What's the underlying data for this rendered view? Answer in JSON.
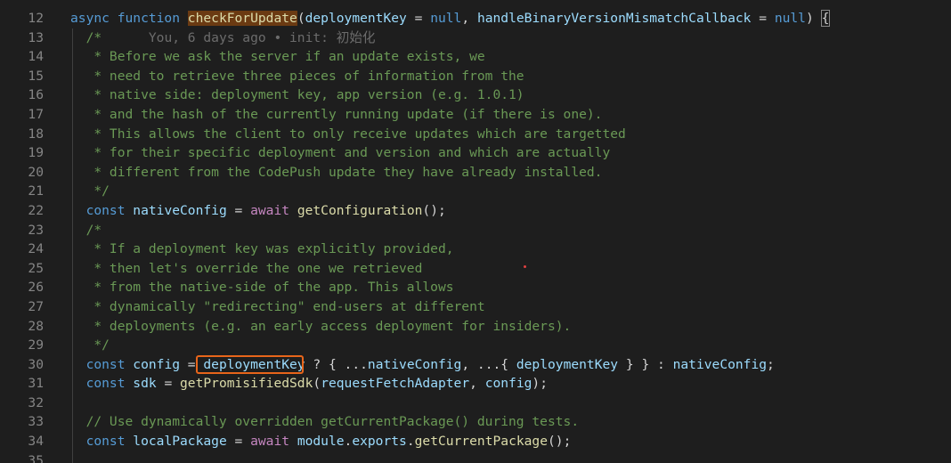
{
  "editor": {
    "lines": [
      {
        "n": "12",
        "parts": [
          {
            "t": "async ",
            "c": "kw"
          },
          {
            "t": "function ",
            "c": "kw"
          },
          {
            "t": "checkForUpdate",
            "c": "fn hl-fn"
          },
          {
            "t": "(",
            "c": "pl"
          },
          {
            "t": "deploymentKey",
            "c": "var"
          },
          {
            "t": " = ",
            "c": "pl"
          },
          {
            "t": "null",
            "c": "kw"
          },
          {
            "t": ", ",
            "c": "pl"
          },
          {
            "t": "handleBinaryVersionMismatchCallback",
            "c": "var"
          },
          {
            "t": " = ",
            "c": "pl"
          },
          {
            "t": "null",
            "c": "kw"
          },
          {
            "t": ") ",
            "c": "pl"
          },
          {
            "t": "{",
            "c": "pl brace"
          }
        ]
      },
      {
        "n": "13",
        "parts": [
          {
            "t": "  /*",
            "c": "cm"
          },
          {
            "t": "      You, 6 days ago • init: 初始化",
            "c": "blame"
          }
        ]
      },
      {
        "n": "14",
        "parts": [
          {
            "t": "   * Before we ask the server if an update exists, we",
            "c": "cm"
          }
        ]
      },
      {
        "n": "15",
        "parts": [
          {
            "t": "   * need to retrieve three pieces of information from the",
            "c": "cm"
          }
        ]
      },
      {
        "n": "16",
        "parts": [
          {
            "t": "   * native side: deployment key, app version (e.g. 1.0.1)",
            "c": "cm"
          }
        ]
      },
      {
        "n": "17",
        "parts": [
          {
            "t": "   * and the hash of the currently running update (if there is one).",
            "c": "cm"
          }
        ]
      },
      {
        "n": "18",
        "parts": [
          {
            "t": "   * This allows the client to only receive updates which are targetted",
            "c": "cm"
          }
        ]
      },
      {
        "n": "19",
        "parts": [
          {
            "t": "   * for their specific deployment and version and which are actually",
            "c": "cm"
          }
        ]
      },
      {
        "n": "20",
        "parts": [
          {
            "t": "   * different from the CodePush update they have already installed.",
            "c": "cm"
          }
        ]
      },
      {
        "n": "21",
        "parts": [
          {
            "t": "   */",
            "c": "cm"
          }
        ]
      },
      {
        "n": "22",
        "parts": [
          {
            "t": "  ",
            "c": "pl"
          },
          {
            "t": "const ",
            "c": "kw"
          },
          {
            "t": "nativeConfig",
            "c": "var"
          },
          {
            "t": " = ",
            "c": "pl"
          },
          {
            "t": "await ",
            "c": "ctl"
          },
          {
            "t": "getConfiguration",
            "c": "fn"
          },
          {
            "t": "();",
            "c": "pl"
          }
        ]
      },
      {
        "n": "23",
        "parts": [
          {
            "t": "  /*",
            "c": "cm"
          }
        ]
      },
      {
        "n": "24",
        "parts": [
          {
            "t": "   * If a deployment key was explicitly provided,",
            "c": "cm"
          }
        ]
      },
      {
        "n": "25",
        "parts": [
          {
            "t": "   * then let's override the one we retrieved",
            "c": "cm"
          }
        ]
      },
      {
        "n": "26",
        "parts": [
          {
            "t": "   * from the native-side of the app. This allows",
            "c": "cm"
          }
        ]
      },
      {
        "n": "27",
        "parts": [
          {
            "t": "   * dynamically \"redirecting\" end-users at different",
            "c": "cm"
          }
        ]
      },
      {
        "n": "28",
        "parts": [
          {
            "t": "   * deployments (e.g. an early access deployment for insiders).",
            "c": "cm"
          }
        ]
      },
      {
        "n": "29",
        "parts": [
          {
            "t": "   */",
            "c": "cm"
          }
        ]
      },
      {
        "n": "30",
        "parts": [
          {
            "t": "  ",
            "c": "pl"
          },
          {
            "t": "const ",
            "c": "kw"
          },
          {
            "t": "config",
            "c": "var"
          },
          {
            "t": " = ",
            "c": "pl"
          },
          {
            "t": "deploymentKey",
            "c": "var"
          },
          {
            "t": " ? { ...",
            "c": "pl"
          },
          {
            "t": "nativeConfig",
            "c": "var"
          },
          {
            "t": ", ...{ ",
            "c": "pl"
          },
          {
            "t": "deploymentKey",
            "c": "var"
          },
          {
            "t": " } } : ",
            "c": "pl"
          },
          {
            "t": "nativeConfig",
            "c": "var"
          },
          {
            "t": ";",
            "c": "pl"
          }
        ]
      },
      {
        "n": "31",
        "parts": [
          {
            "t": "  ",
            "c": "pl"
          },
          {
            "t": "const ",
            "c": "kw"
          },
          {
            "t": "sdk",
            "c": "var"
          },
          {
            "t": " = ",
            "c": "pl"
          },
          {
            "t": "getPromisifiedSdk",
            "c": "fn"
          },
          {
            "t": "(",
            "c": "pl"
          },
          {
            "t": "requestFetchAdapter",
            "c": "var"
          },
          {
            "t": ", ",
            "c": "pl"
          },
          {
            "t": "config",
            "c": "var"
          },
          {
            "t": ");",
            "c": "pl"
          }
        ]
      },
      {
        "n": "32",
        "parts": []
      },
      {
        "n": "33",
        "parts": [
          {
            "t": "  // Use dynamically overridden getCurrentPackage() during tests.",
            "c": "cm"
          }
        ]
      },
      {
        "n": "34",
        "parts": [
          {
            "t": "  ",
            "c": "pl"
          },
          {
            "t": "const ",
            "c": "kw"
          },
          {
            "t": "localPackage",
            "c": "var"
          },
          {
            "t": " = ",
            "c": "pl"
          },
          {
            "t": "await ",
            "c": "ctl"
          },
          {
            "t": "module",
            "c": "var"
          },
          {
            "t": ".",
            "c": "pl"
          },
          {
            "t": "exports",
            "c": "var"
          },
          {
            "t": ".",
            "c": "pl"
          },
          {
            "t": "getCurrentPackage",
            "c": "fn"
          },
          {
            "t": "();",
            "c": "pl"
          }
        ]
      },
      {
        "n": "35",
        "parts": []
      }
    ],
    "colors": {
      "background": "#1e1e1e",
      "keyword": "#569cd6",
      "control": "#c586c0",
      "function": "#dcdcaa",
      "variable": "#9cdcfe",
      "comment": "#6a9955",
      "highlight_box": "#e8651a"
    }
  }
}
